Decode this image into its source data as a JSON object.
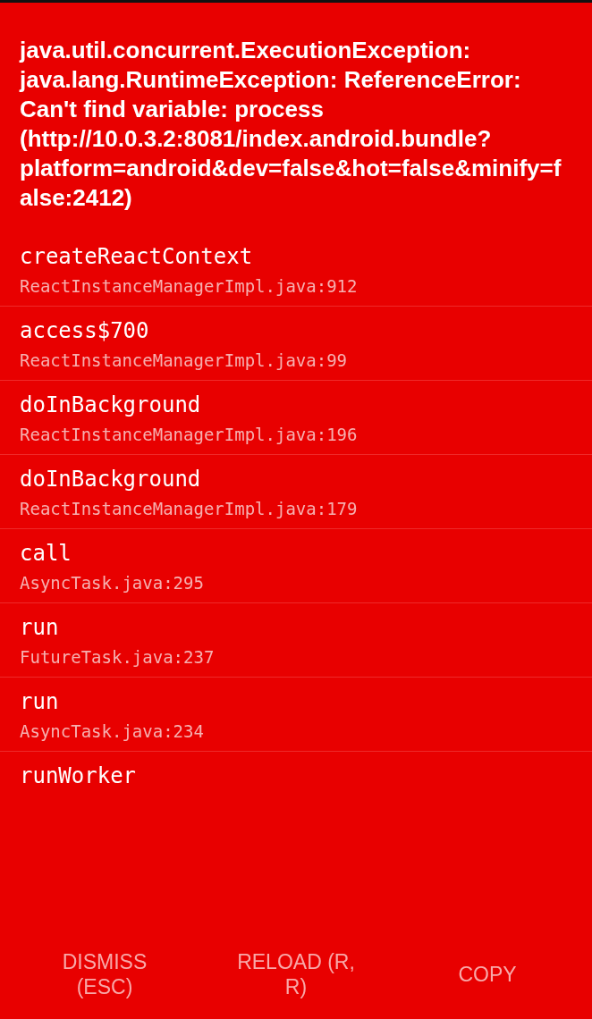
{
  "error_message": "java.util.concurrent.ExecutionException: java.lang.RuntimeException: ReferenceError: Can't find variable: process (http://10.0.3.2:8081/index.android.bundle?platform=android&dev=false&hot=false&minify=false:2412)",
  "stack_frames": [
    {
      "method": "createReactContext",
      "location": "ReactInstanceManagerImpl.java:912"
    },
    {
      "method": "access$700",
      "location": "ReactInstanceManagerImpl.java:99"
    },
    {
      "method": "doInBackground",
      "location": "ReactInstanceManagerImpl.java:196"
    },
    {
      "method": "doInBackground",
      "location": "ReactInstanceManagerImpl.java:179"
    },
    {
      "method": "call",
      "location": "AsyncTask.java:295"
    },
    {
      "method": "run",
      "location": "FutureTask.java:237"
    },
    {
      "method": "run",
      "location": "AsyncTask.java:234"
    },
    {
      "method": "runWorker"
    }
  ],
  "buttons": [
    "DISMISS (ESC)",
    "RELOAD (R, R)",
    "COPY"
  ]
}
